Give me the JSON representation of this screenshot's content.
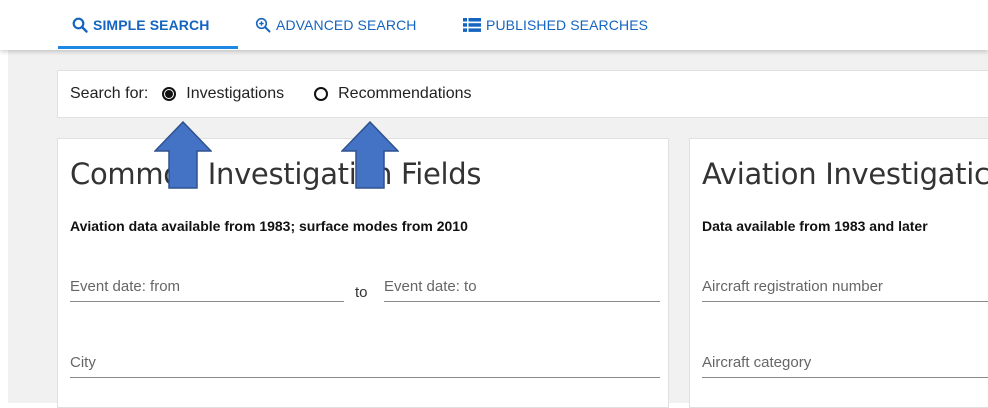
{
  "tabs": [
    {
      "label": "SIMPLE SEARCH",
      "icon": "search-icon",
      "active": true
    },
    {
      "label": "ADVANCED SEARCH",
      "icon": "zoom-in-icon",
      "active": false
    },
    {
      "label": "PUBLISHED SEARCHES",
      "icon": "list-icon",
      "active": false
    }
  ],
  "search_for": {
    "label": "Search for:",
    "options": [
      {
        "label": "Investigations",
        "selected": true
      },
      {
        "label": "Recommendations",
        "selected": false
      }
    ]
  },
  "common_card": {
    "title": "Common Investigation Fields",
    "subtitle": "Aviation data available from 1983; surface modes from 2010",
    "fields": {
      "event_date_from": "Event date: from",
      "to_label": "to",
      "event_date_to": "Event date: to",
      "city": "City"
    }
  },
  "aviation_card": {
    "title": "Aviation Investigatic",
    "subtitle": "Data available from 1983 and later",
    "fields": {
      "registration": "Aircraft registration number",
      "category": "Aircraft category"
    }
  },
  "colors": {
    "accent": "#1565c0",
    "tab_underline": "#1e88e5",
    "arrow_fill": "#4472c4",
    "arrow_stroke": "#2f528f",
    "page_bg": "#f1f1f1"
  }
}
